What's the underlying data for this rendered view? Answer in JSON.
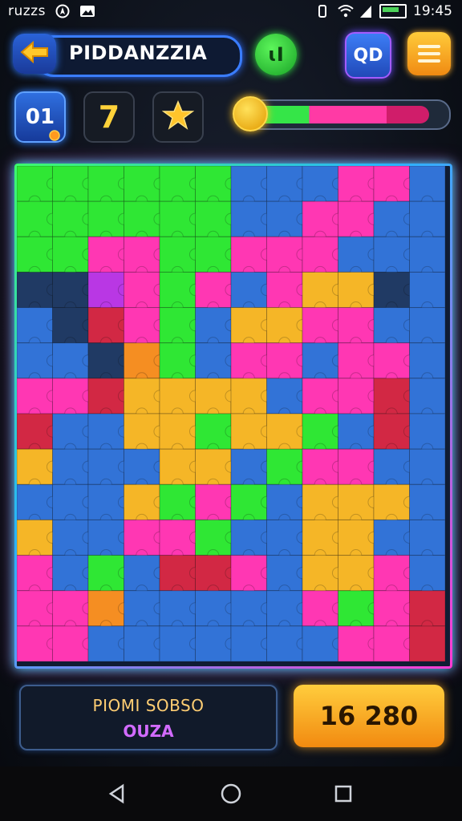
{
  "status_bar": {
    "left_text": "ruzzs",
    "time": "19:45"
  },
  "header": {
    "title": "PIDDANZZIA",
    "green_button_label": "ɩI",
    "cube_button_label": "QD"
  },
  "stats": {
    "level": "01",
    "moves": "7"
  },
  "progress": {
    "fraction": 0.92,
    "colors": [
      "#35e548",
      "#ff3aa5",
      "#d01d6a"
    ]
  },
  "board": {
    "columns": 12,
    "rows": 14,
    "palette": {
      "G": "#27e62c",
      "B": "#2a6ed6",
      "N": "#17325e",
      "P": "#ff2fb0",
      "M": "#b72fe3",
      "Y": "#f5b41f",
      "O": "#f58a1a",
      "R": "#d1203d",
      "C": "#1fa3ff"
    },
    "grid": [
      "GGGGGGBBBPPB",
      "GGGGGGBBPPBB",
      "GGPPGGPPPBBB",
      "NNMPGPBPYYNB",
      "BNRPGBYYPPBB",
      "BBNOGBPPBPPB",
      "PPRYYYYBPPRB",
      "RBBYYGYYGBRB",
      "YBBBYYBGPPBB",
      "BBBYGPGBYYYB",
      "YBBPPGBBYYBB",
      "PBGBRRPBYYPB",
      "PPOBBBBBPGPR",
      "PPBBBBBBBPPR"
    ]
  },
  "bottom": {
    "info_line1": "PIOMI SOBSO",
    "info_line2": "OUZA",
    "score": "16 280"
  }
}
